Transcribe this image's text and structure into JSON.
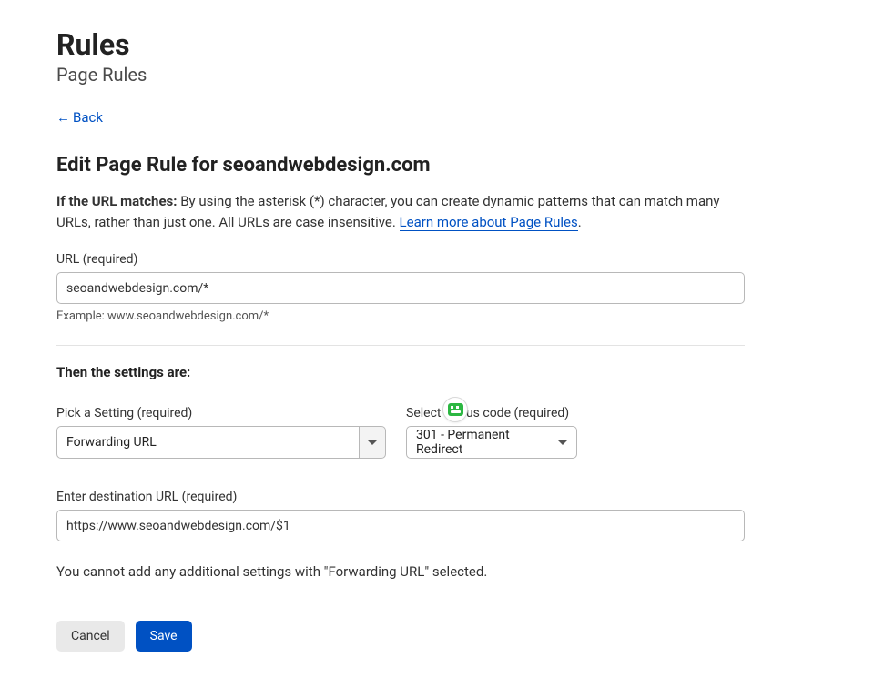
{
  "header": {
    "title": "Rules",
    "subtitle": "Page Rules"
  },
  "back": {
    "label": " Back"
  },
  "edit": {
    "heading_prefix": "Edit Page Rule for ",
    "domain": "seoandwebdesign.com"
  },
  "desc": {
    "strong": "If the URL matches:",
    "body": " By using the asterisk (*) character, you can create dynamic patterns that can match many URLs, rather than just one. All URLs are case insensitive. ",
    "link_text": "Learn more about Page Rules",
    "period": "."
  },
  "url_field": {
    "label": "URL (required)",
    "value": "seoandwebdesign.com/*",
    "hint": "Example: www.seoandwebdesign.com/*"
  },
  "then_heading": "Then the settings are:",
  "setting_select": {
    "label": "Pick a Setting (required)",
    "value": "Forwarding URL"
  },
  "status_select": {
    "label": "Select status code (required)",
    "value": "301 - Permanent Redirect"
  },
  "dest_field": {
    "label": "Enter destination URL (required)",
    "value": "https://www.seoandwebdesign.com/$1"
  },
  "note": "You cannot add any additional settings with \"Forwarding URL\" selected.",
  "buttons": {
    "cancel": "Cancel",
    "save": "Save"
  }
}
